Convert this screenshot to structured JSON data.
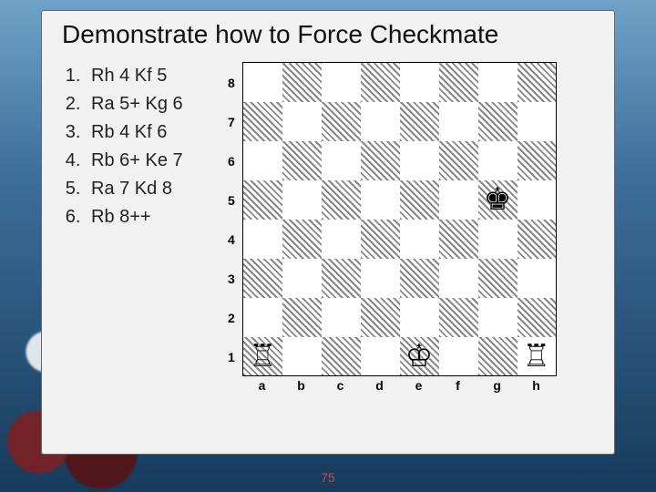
{
  "title": "Demonstrate how to Force Checkmate",
  "moves": [
    "Rh 4 Kf 5",
    "Ra 5+ Kg 6",
    "Rb 4 Kf 6",
    "Rb 6+ Ke 7",
    "Ra 7 Kd 8",
    "Rb 8++"
  ],
  "board": {
    "ranks": [
      "8",
      "7",
      "6",
      "5",
      "4",
      "3",
      "2",
      "1"
    ],
    "files": [
      "a",
      "b",
      "c",
      "d",
      "e",
      "f",
      "g",
      "h"
    ],
    "pieces": [
      {
        "square": "g5",
        "glyph": "♚",
        "name": "black-king"
      },
      {
        "square": "a1",
        "glyph": "♖",
        "name": "white-rook-a"
      },
      {
        "square": "e1",
        "glyph": "♔",
        "name": "white-king"
      },
      {
        "square": "h1",
        "glyph": "♖",
        "name": "white-rook-h"
      }
    ]
  },
  "page_number": "75"
}
